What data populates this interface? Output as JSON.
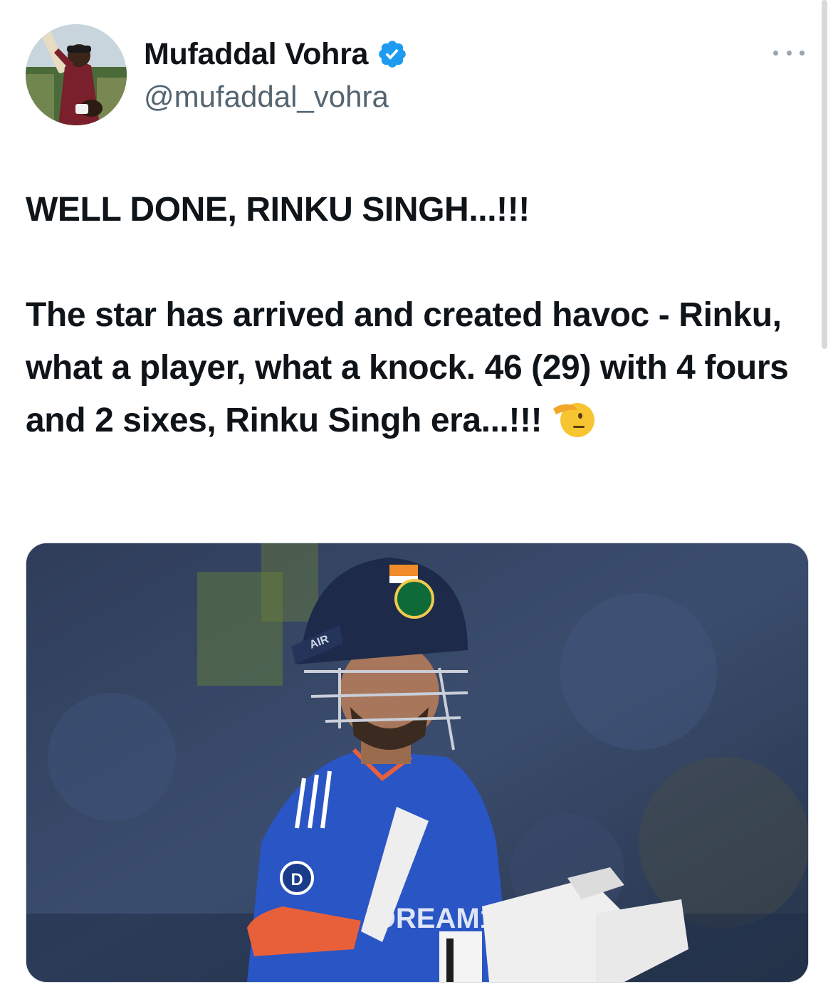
{
  "author": {
    "display_name": "Mufaddal Vohra",
    "handle": "@mufaddal_vohra",
    "verified": true,
    "verified_color": "#1d9bf0",
    "avatar": "avatar-cricketer-photo"
  },
  "header": {
    "more_icon": "more-horizontal-icon"
  },
  "tweet": {
    "headline": "WELL DONE, RINKU SINGH...!!!",
    "body": "The star has arrived and created havoc - Rinku, what a player, what a knock. 46 (29) with 4 fours and 2 sixes, Rinku Singh era...!!!",
    "emoji": "saluting-face-emoji"
  },
  "media": {
    "type": "photo",
    "description_icon": "cricketer-in-blue-jersey-photo",
    "helmet_text": "AIR",
    "jersey_text": "DREAM11"
  },
  "colors": {
    "text_primary": "#0f1419",
    "text_secondary": "#536471",
    "jersey_blue": "#2a55c4",
    "jersey_orange": "#e8603a"
  }
}
